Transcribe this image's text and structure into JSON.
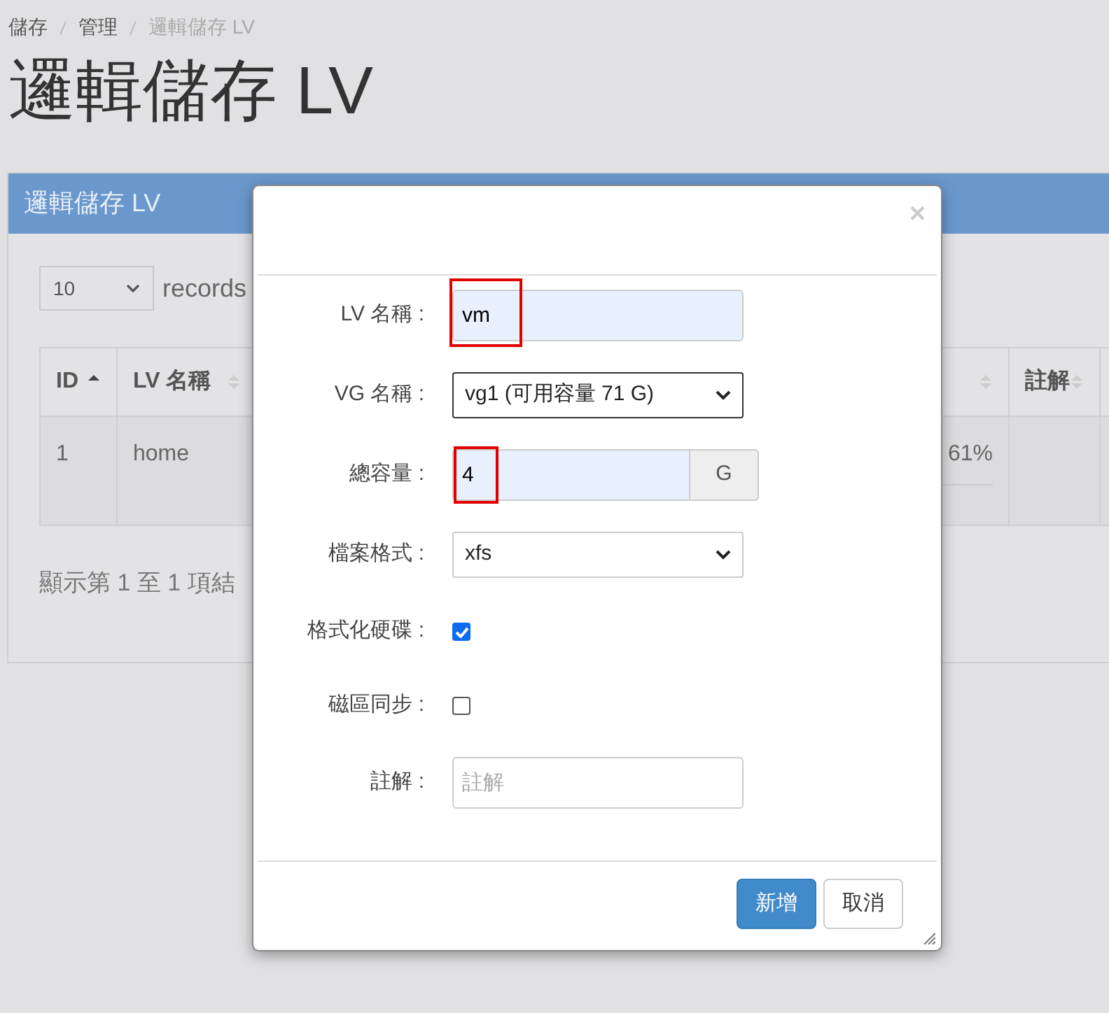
{
  "breadcrumb": [
    {
      "label": "儲存",
      "current": false
    },
    {
      "label": "管理",
      "current": false
    },
    {
      "label": "邏輯儲存 LV",
      "current": true
    }
  ],
  "page_title": "邏輯儲存 LV",
  "panel": {
    "title": "邏輯儲存 LV",
    "page_size": "10",
    "page_size_suffix": "records",
    "table": {
      "columns": [
        {
          "label": "ID",
          "sorted": true
        },
        {
          "label": "LV 名稱",
          "sorted": false
        },
        {
          "sorted": false
        },
        {
          "label": "註解",
          "sorted": false
        }
      ],
      "rows": [
        {
          "id": "1",
          "lv_name": "home",
          "column_4": "61%"
        }
      ]
    },
    "info": "顯示第 1 至 1 項結"
  },
  "dialog": {
    "close": "×",
    "fields": [
      {
        "kind": "text",
        "label": "LV 名稱 :",
        "value": "vm",
        "highlighted": true
      },
      {
        "kind": "select",
        "label": "VG 名稱 :",
        "value": "vg1 (可用容量 71 G)"
      },
      {
        "kind": "addon",
        "label": "總容量 :",
        "value": "4",
        "addon": "G",
        "highlighted": true
      },
      {
        "kind": "select",
        "label": "檔案格式 :",
        "value": "xfs"
      },
      {
        "kind": "checkbox",
        "label": "格式化硬碟 :",
        "checked": true
      },
      {
        "kind": "checkbox",
        "label": "磁區同步 :",
        "checked": false
      },
      {
        "kind": "text",
        "label": "註解 :",
        "placeholder": "註解"
      }
    ],
    "buttons": [
      {
        "label": "新增",
        "primary": true
      },
      {
        "label": "取消",
        "primary": false
      }
    ]
  }
}
